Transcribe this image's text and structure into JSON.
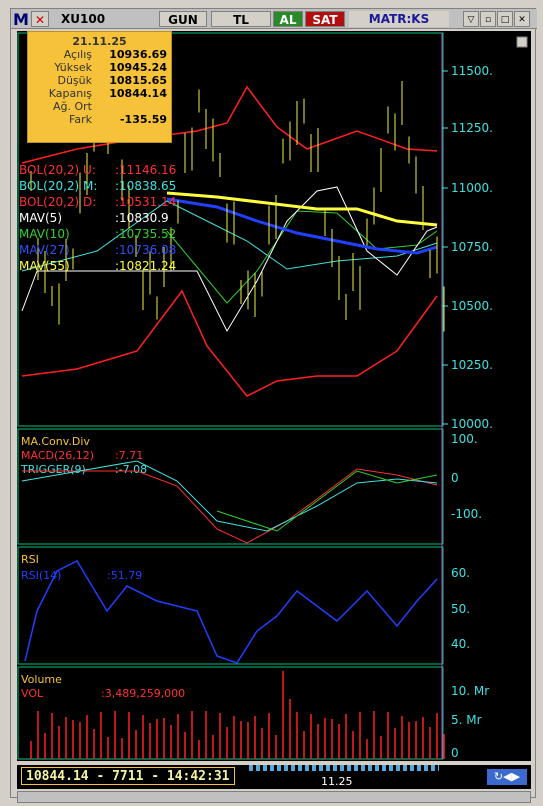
{
  "toolbar": {
    "symbol": "XU100",
    "period": "GUN",
    "currency": "TL",
    "al": "AL",
    "sat": "SAT",
    "brand": "MATR:KS"
  },
  "info": {
    "date": "21.11.25",
    "rows": [
      [
        "Açılış",
        "10936.69"
      ],
      [
        "Yüksek",
        "10945.24"
      ],
      [
        "Düşük",
        "10815.65"
      ],
      [
        "Kapanış",
        "10844.14"
      ],
      [
        "Ağ. Ort",
        ""
      ],
      [
        "Fark",
        "-135.59"
      ]
    ]
  },
  "price_legend": [
    {
      "label": "BOL(20,2) U:",
      "value": ":11146.16",
      "color": "#ff3030"
    },
    {
      "label": "BOL(20,2) M:",
      "value": ":10838.65",
      "color": "#40e0e0"
    },
    {
      "label": "BOL(20,2) D:",
      "value": ":10531.14",
      "color": "#ff3030"
    },
    {
      "label": "MAV(5)",
      "value": ":10830.9",
      "color": "#ffffff"
    },
    {
      "label": "MAV(10)",
      "value": ":10735.52",
      "color": "#30d030"
    },
    {
      "label": "MAV(27)",
      "value": ":10736.08",
      "color": "#3050ff"
    },
    {
      "label": "MAV(55)",
      "value": ":10821.24",
      "color": "#ffff40"
    }
  ],
  "price_axis": [
    "11500.",
    "11250.",
    "11000.",
    "10750.",
    "10500.",
    "10250.",
    "10000."
  ],
  "macd": {
    "title": "MA.Conv.Div",
    "l1": "MACD(26,12)",
    "v1": ":7.71",
    "l2": "TRIGGER(9)",
    "v2": ":-7.08",
    "axis": [
      "100.",
      "0",
      "-100."
    ]
  },
  "rsi": {
    "title": "RSI",
    "l1": "RSI(14)",
    "v1": ":51.79",
    "axis": [
      "60.",
      "50.",
      "40."
    ]
  },
  "volume": {
    "title": "Volume",
    "l1": "VOL",
    "v1": ":3,489,259,000",
    "axis": [
      "10. Mr",
      "5. Mr",
      "0"
    ]
  },
  "status": {
    "value": "10844.14 - 7711 - 14:42:31",
    "date": "11.25"
  },
  "colors": {
    "bg": "#000000",
    "grid": "#00ffb0",
    "axis": "#40e0e0",
    "bol": "#ff2020",
    "close": "#f0f040"
  },
  "chart_data": {
    "type": "line",
    "price": {
      "ylim": [
        10000,
        11500
      ]
    },
    "macd": {
      "ylim": [
        -150,
        150
      ]
    },
    "rsi": {
      "ylim": [
        30,
        65
      ]
    },
    "volume": {
      "ylim": [
        0,
        12
      ]
    }
  }
}
